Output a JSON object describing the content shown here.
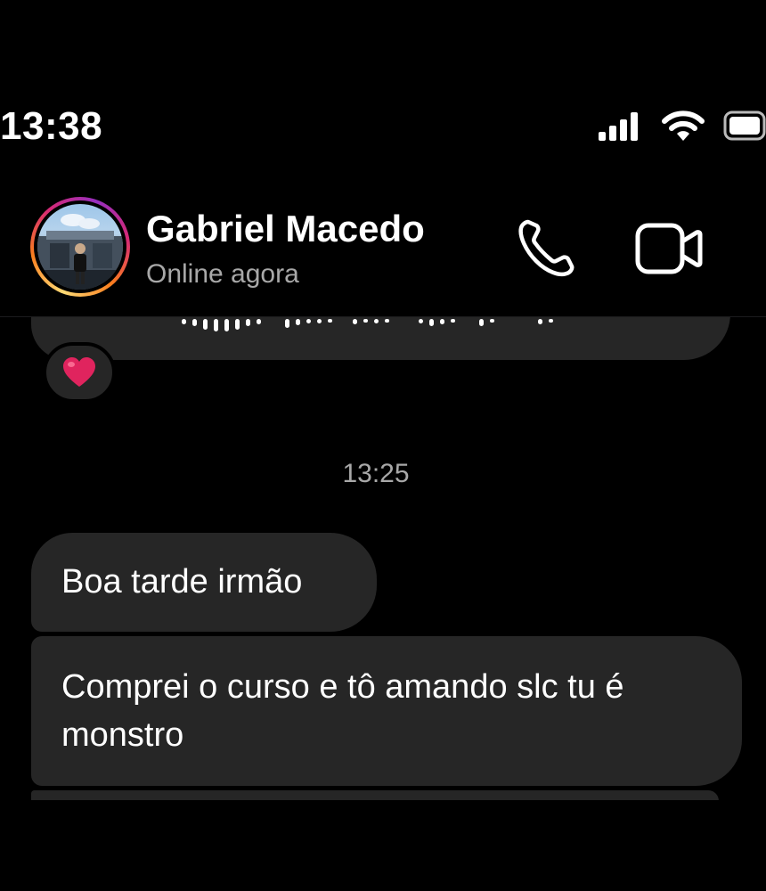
{
  "status_bar": {
    "time": "13:38",
    "signal_icon": "cellular-signal-icon",
    "wifi_icon": "wifi-icon",
    "battery_icon": "battery-icon"
  },
  "header": {
    "contact_name": "Gabriel Macedo",
    "contact_status": "Online agora",
    "call_icon": "phone-icon",
    "video_icon": "video-camera-icon"
  },
  "messages": {
    "audio_reaction": "❤️",
    "timestamp": "13:25",
    "items": [
      {
        "text": "Boa tarde irmão"
      },
      {
        "text": "Comprei o curso e tô amando slc tu é monstro"
      }
    ]
  },
  "colors": {
    "background": "#000000",
    "bubble": "#262626",
    "secondary_text": "#a8a8a8",
    "heart": "#e0245e"
  }
}
